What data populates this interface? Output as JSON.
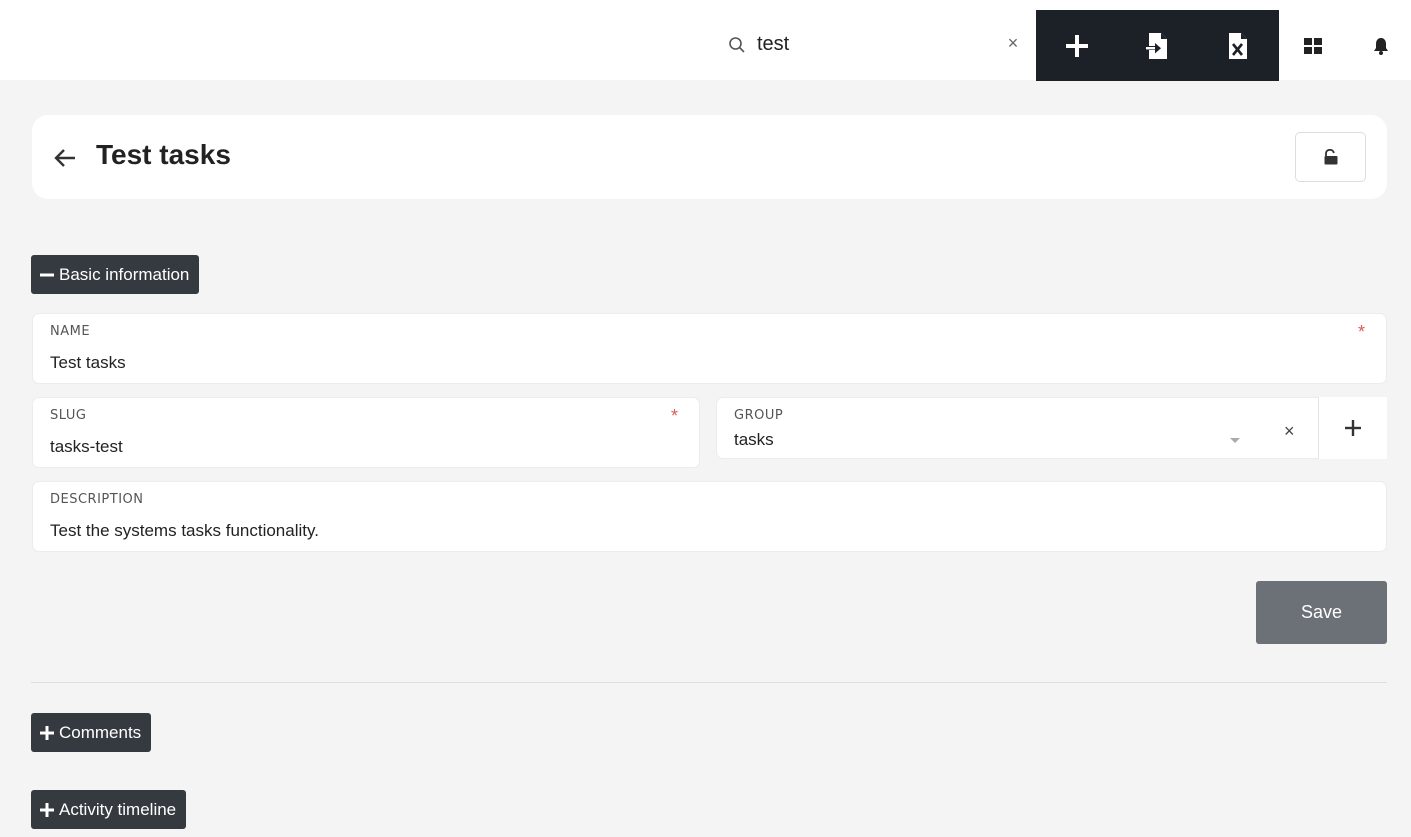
{
  "topbar": {
    "search": {
      "value": "test",
      "clear_symbol": "×",
      "icon": "search-icon"
    },
    "actions": [
      {
        "name": "add-icon"
      },
      {
        "name": "import-icon"
      },
      {
        "name": "export-excel-icon"
      },
      {
        "name": "grid-icon"
      },
      {
        "name": "bell-icon"
      }
    ]
  },
  "header": {
    "title": "Test tasks",
    "back_icon": "arrow-left-icon",
    "lock_icon": "unlock-icon"
  },
  "sections": {
    "basic": {
      "label": "Basic information",
      "expanded": true
    },
    "comments": {
      "label": "Comments",
      "expanded": false
    },
    "activity": {
      "label": "Activity timeline",
      "expanded": false
    }
  },
  "form": {
    "name": {
      "label": "NAME",
      "value": "Test tasks",
      "required": "*"
    },
    "slug": {
      "label": "SLUG",
      "value": "tasks-test",
      "required": "*"
    },
    "group": {
      "label": "GROUP",
      "value": "tasks",
      "clear_symbol": "×"
    },
    "description": {
      "label": "DESCRIPTION",
      "value": "Test the systems tasks functionality."
    }
  },
  "actions": {
    "save_label": "Save"
  },
  "colors": {
    "dark": "#1c2128",
    "section_button": "#343a40",
    "save_button": "#6c7177",
    "required": "#e05a5a",
    "background": "#f4f4f4"
  }
}
